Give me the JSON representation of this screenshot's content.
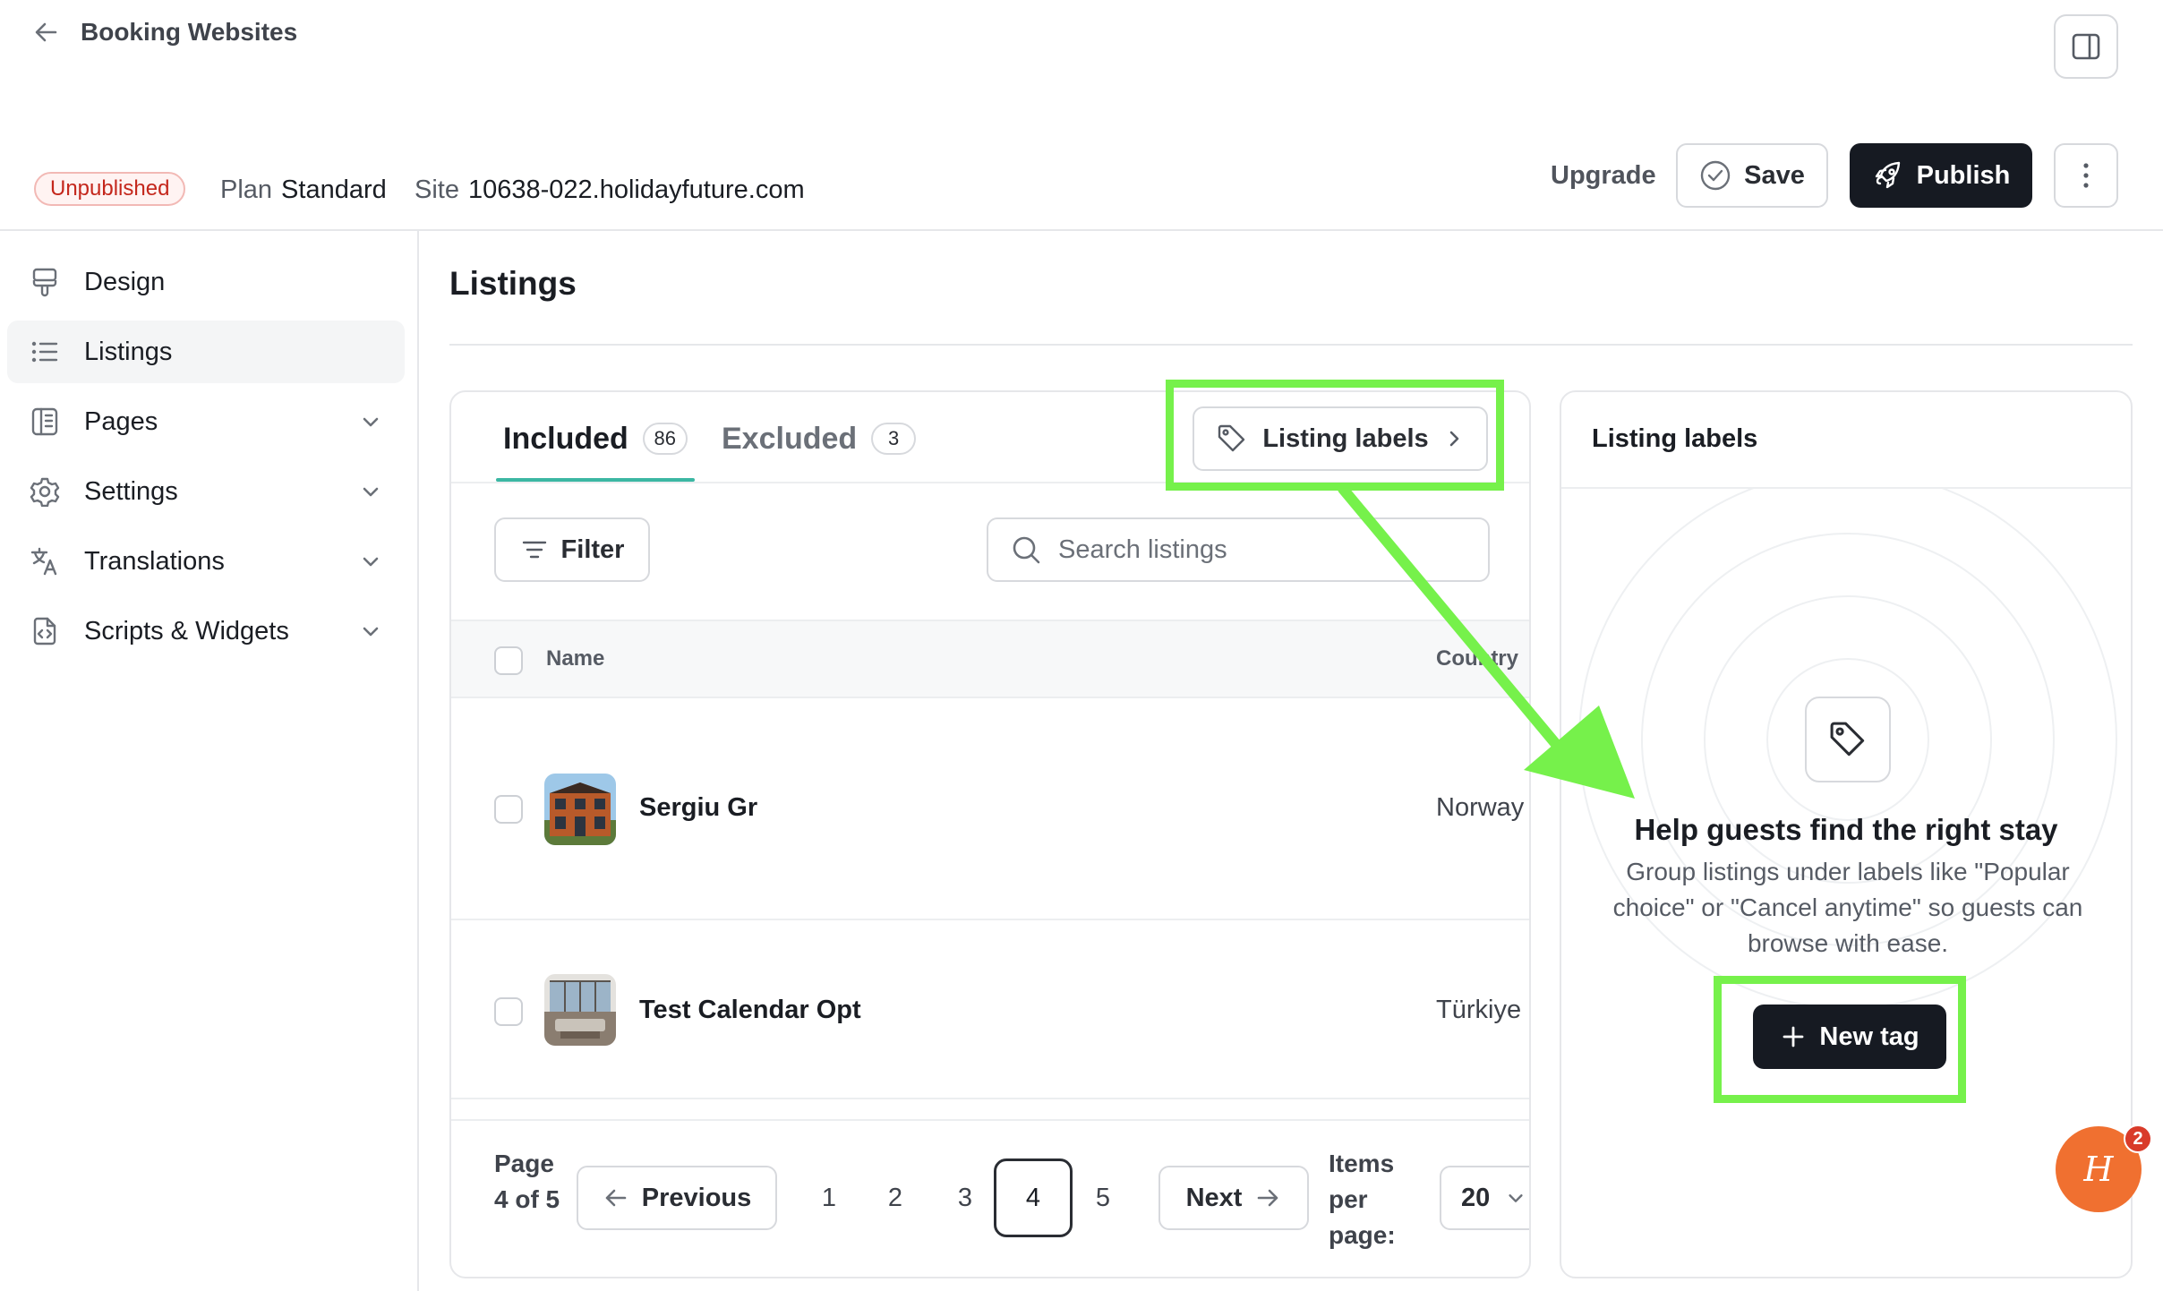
{
  "header": {
    "back_label": "Booking Websites",
    "status_badge": "Unpublished",
    "plan_label": "Plan",
    "plan_value": "Standard",
    "site_label": "Site",
    "site_value": "10638-022.holidayfuture.com",
    "upgrade_label": "Upgrade",
    "save_label": "Save",
    "publish_label": "Publish"
  },
  "sidebar": {
    "items": [
      {
        "label": "Design",
        "icon": "paintbrush-icon",
        "active": false,
        "expandable": false
      },
      {
        "label": "Listings",
        "icon": "list-icon",
        "active": true,
        "expandable": false
      },
      {
        "label": "Pages",
        "icon": "pages-icon",
        "active": false,
        "expandable": true
      },
      {
        "label": "Settings",
        "icon": "gear-icon",
        "active": false,
        "expandable": true
      },
      {
        "label": "Translations",
        "icon": "translate-icon",
        "active": false,
        "expandable": true
      },
      {
        "label": "Scripts & Widgets",
        "icon": "code-file-icon",
        "active": false,
        "expandable": true
      }
    ]
  },
  "main": {
    "title": "Listings",
    "tabs": [
      {
        "label": "Included",
        "count": "86",
        "active": true
      },
      {
        "label": "Excluded",
        "count": "3",
        "active": false
      }
    ],
    "listing_labels_button": "Listing labels",
    "filter_label": "Filter",
    "search": {
      "placeholder": "Search listings",
      "value": ""
    },
    "table": {
      "columns": [
        "Name",
        "Country"
      ],
      "rows": [
        {
          "name": "Sergiu Gr",
          "country": "Norway"
        },
        {
          "name": "Test Calendar Opt",
          "country": "Türkiye"
        }
      ]
    },
    "pagination": {
      "page_info": "Page 4 of 5",
      "previous_label": "Previous",
      "next_label": "Next",
      "pages": [
        "1",
        "2",
        "3",
        "4",
        "5"
      ],
      "current_page": "4",
      "items_per_page_label": "Items per page:",
      "items_per_page_value": "20"
    }
  },
  "side_panel": {
    "title": "Listing labels",
    "empty_title": "Help guests find the right stay",
    "empty_description": "Group listings under labels like \"Popular choice\" or \"Cancel anytime\" so guests can browse with ease.",
    "new_tag_label": "New tag"
  },
  "chat_widget": {
    "badge_count": "2",
    "logo_letter": "H"
  },
  "colors": {
    "accent_tab": "#3bb7a3",
    "primary_button": "#161a22",
    "status_badge_text": "#c4271c",
    "annotation_highlight": "#76f14b",
    "chat_bubble": "#f07030"
  }
}
